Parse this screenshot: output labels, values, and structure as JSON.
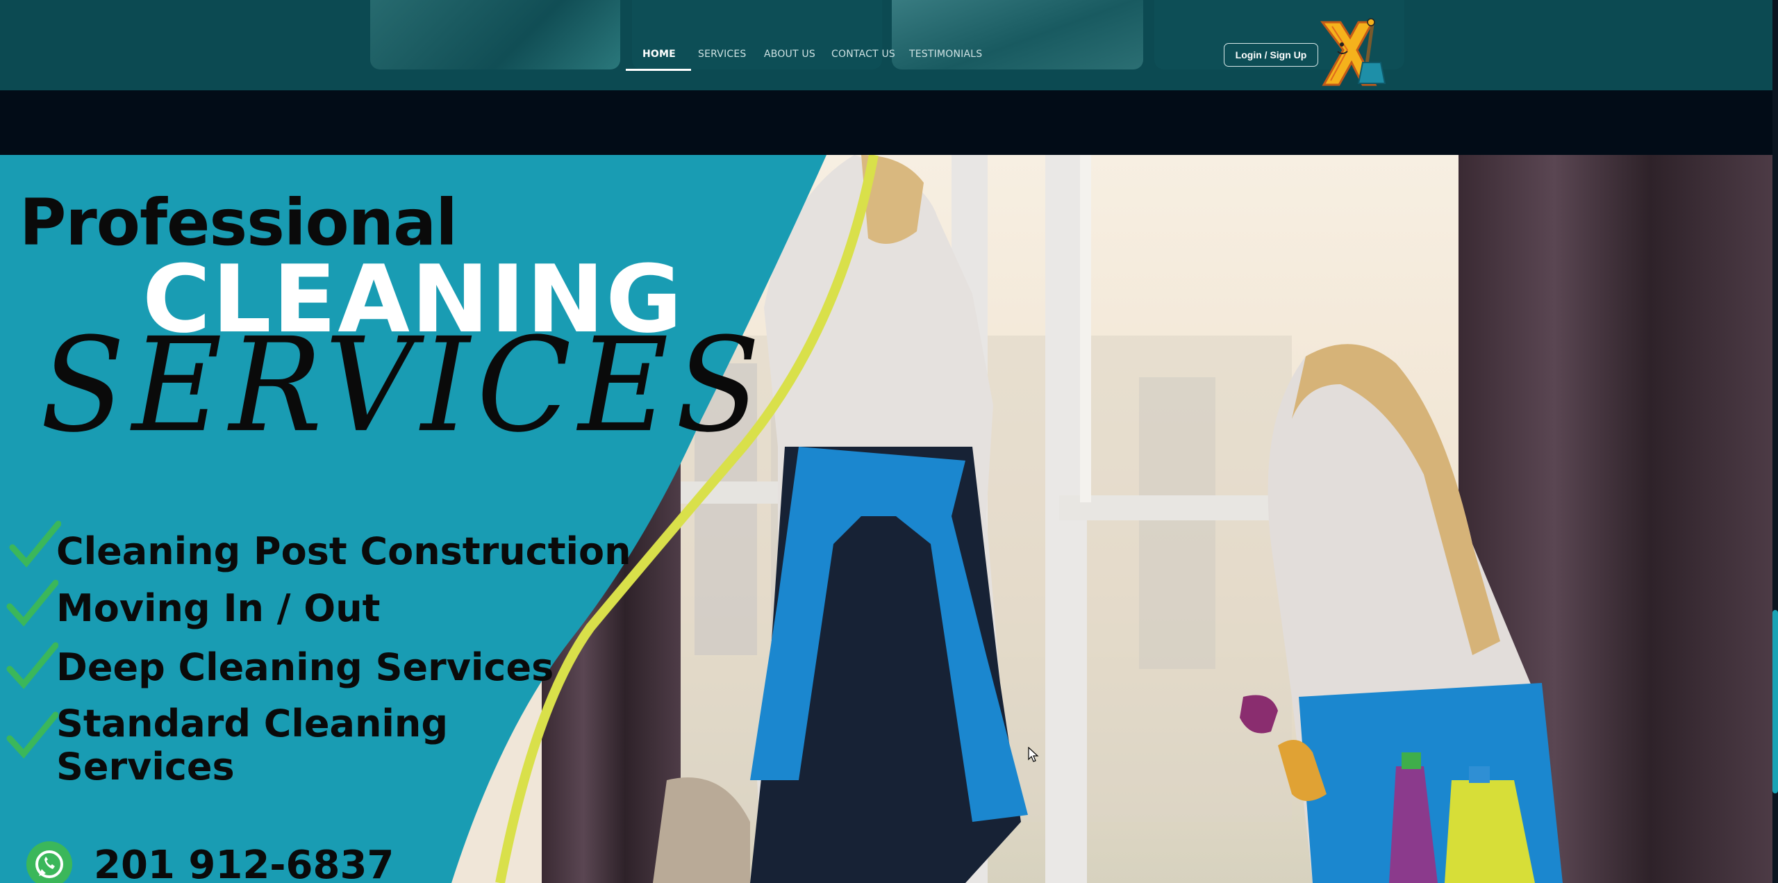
{
  "nav": {
    "items": [
      {
        "label": "HOME",
        "active": true
      },
      {
        "label": "SERVICES",
        "active": false
      },
      {
        "label": "ABOUT US",
        "active": false
      },
      {
        "label": "CONTACT US",
        "active": false
      },
      {
        "label": "TESTIMONIALS",
        "active": false
      }
    ],
    "login_label": "Login / Sign Up"
  },
  "hero": {
    "line1": "Professional",
    "line2": "CLEANING",
    "line3": "SERVICES",
    "services": [
      "Cleaning Post Construction",
      "Moving In / Out",
      "Deep Cleaning Services",
      "Standard Cleaning",
      "Services"
    ],
    "phone": "201 912-6837"
  },
  "colors": {
    "header_bg": "#0c4a52",
    "hero_teal": "#199cb3",
    "accent_yellow": "#d9e04a",
    "check_green": "#3bb75a",
    "band_dark": "#020c17"
  },
  "icons": [
    "logo-icon",
    "check-icon",
    "whatsapp-icon",
    "cursor-icon"
  ]
}
